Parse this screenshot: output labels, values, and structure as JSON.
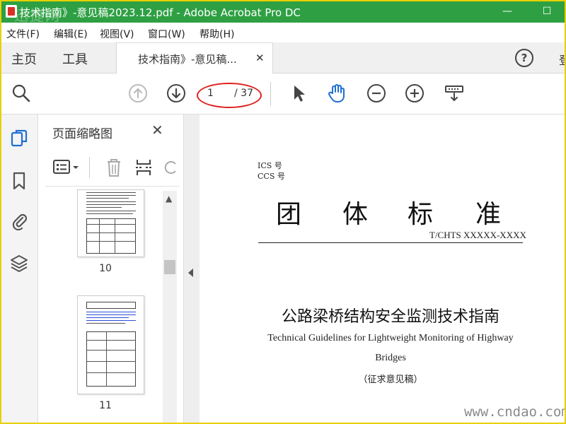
{
  "window": {
    "title": "技术指南》-意见稿2023.12.pdf - Adobe Acrobat Pro DC",
    "watermark": "迅捷网",
    "minimize": "—",
    "maximize": "☐"
  },
  "menu": [
    "文件(F)",
    "编辑(E)",
    "视图(V)",
    "窗口(W)",
    "帮助(H)"
  ],
  "tabs": {
    "home": "主页",
    "tools": "工具",
    "document": "技术指南》-意见稿...",
    "close": "✕",
    "help": "?",
    "login": "登"
  },
  "toolbar": {
    "current_page": "1",
    "total_pages": "/ 37"
  },
  "panel": {
    "title": "页面缩略图",
    "close": "✕",
    "thumbnails": [
      {
        "label": "10"
      },
      {
        "label": "11"
      }
    ]
  },
  "document": {
    "ics": "ICS 号",
    "ccs": "CCS 号",
    "big_title_chars": [
      "团",
      "体",
      "标",
      "准"
    ],
    "standard_no": "T/CHTS XXXXX-XXXX",
    "title_cn": "公路梁桥结构安全监测技术指南",
    "title_en_line1": "Technical Guidelines for Lightweight Monitoring of Highway",
    "title_en_line2": "Bridges",
    "draft_note": "（征求意见稿）"
  },
  "watermark_bottom": "www.cndao.com",
  "colors": {
    "titlebar": "#2ea043",
    "frame": "#e8d000",
    "annotation": "#e02020",
    "active_icon": "#1f6fd1"
  }
}
